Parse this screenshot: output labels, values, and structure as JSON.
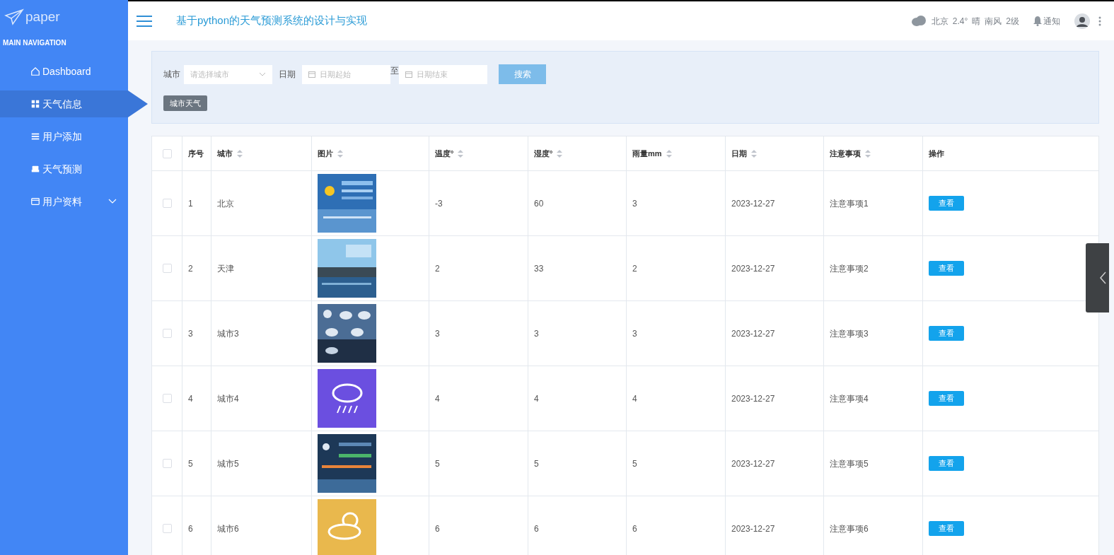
{
  "logo": {
    "text": "paper"
  },
  "sidebar": {
    "heading": "MAIN NAVIGATION",
    "items": [
      {
        "label": "Dashboard",
        "selected": false
      },
      {
        "label": "天气信息",
        "selected": true
      },
      {
        "label": "用户添加",
        "selected": false
      },
      {
        "label": "天气预测",
        "selected": false
      },
      {
        "label": "用户资料",
        "selected": false,
        "expanded": false
      }
    ]
  },
  "header": {
    "title": "基于python的天气预测系统的设计与实现",
    "weather": [
      "北京",
      "2.4°",
      "晴",
      "南风",
      "2级"
    ],
    "notify": "通知"
  },
  "filter": {
    "city_label": "城市",
    "city_placeholder": "请选择城市",
    "date_label": "日期",
    "date_start_placeholder": "日期起始",
    "date_sep": "至",
    "date_end_placeholder": "日期结束",
    "search": "搜索",
    "tag": "城市天气"
  },
  "table": {
    "header_checked": false,
    "columns": [
      {
        "label": "序号",
        "sortable": false
      },
      {
        "label": "城市",
        "sortable": true
      },
      {
        "label": "图片",
        "sortable": true
      },
      {
        "label": "温度°",
        "sortable": true
      },
      {
        "label": "湿度°",
        "sortable": true
      },
      {
        "label": "雨量mm",
        "sortable": true
      },
      {
        "label": "日期",
        "sortable": true
      },
      {
        "label": "注意事项",
        "sortable": true
      },
      {
        "label": "操作",
        "sortable": false
      }
    ],
    "rows": [
      {
        "checked": false,
        "no": "1",
        "city": "北京",
        "temp": "-3",
        "humidity": "60",
        "rain": "3",
        "date": "2023-12-27",
        "note": "注意事项1",
        "action": "查看"
      },
      {
        "checked": false,
        "no": "2",
        "city": "天津",
        "temp": "2",
        "humidity": "33",
        "rain": "2",
        "date": "2023-12-27",
        "note": "注意事项2",
        "action": "查看"
      },
      {
        "checked": false,
        "no": "3",
        "city": "城市3",
        "temp": "3",
        "humidity": "3",
        "rain": "3",
        "date": "2023-12-27",
        "note": "注意事项3",
        "action": "查看"
      },
      {
        "checked": false,
        "no": "4",
        "city": "城市4",
        "temp": "4",
        "humidity": "4",
        "rain": "4",
        "date": "2023-12-27",
        "note": "注意事项4",
        "action": "查看"
      },
      {
        "checked": false,
        "no": "5",
        "city": "城市5",
        "temp": "5",
        "humidity": "5",
        "rain": "5",
        "date": "2023-12-27",
        "note": "注意事项5",
        "action": "查看"
      },
      {
        "checked": false,
        "no": "6",
        "city": "城市6",
        "temp": "6",
        "humidity": "6",
        "rain": "6",
        "date": "2023-12-27",
        "note": "注意事项6",
        "action": "查看"
      }
    ]
  }
}
